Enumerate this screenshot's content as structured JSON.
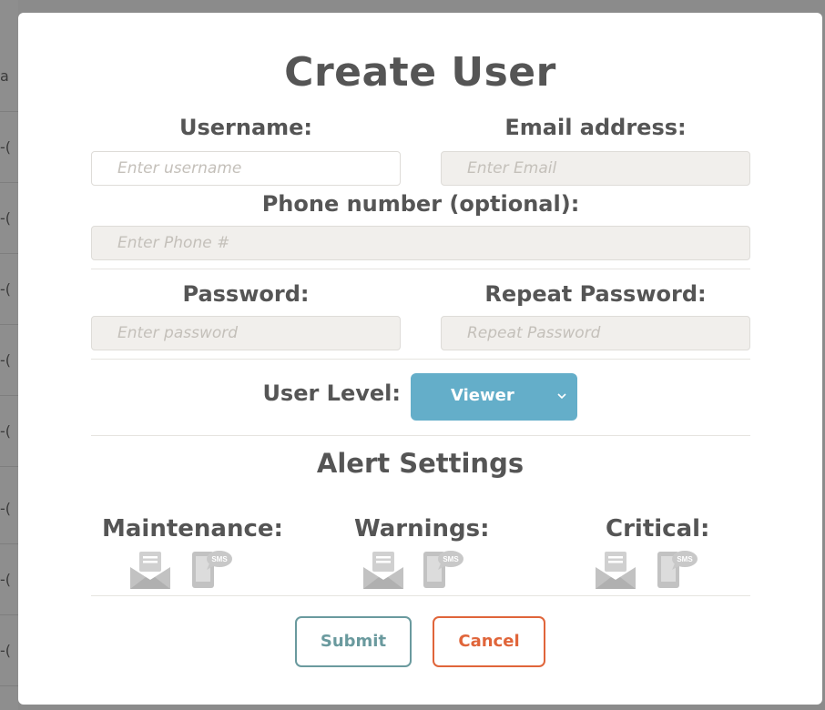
{
  "background": {
    "cells": [
      "a",
      "-(",
      "-(",
      "-(",
      "-(",
      "-(",
      "-(",
      "-(",
      "-("
    ]
  },
  "modal": {
    "title": "Create User",
    "fields": {
      "username": {
        "label": "Username:",
        "placeholder": "Enter username",
        "value": ""
      },
      "email": {
        "label": "Email address:",
        "placeholder": "Enter Email",
        "value": ""
      },
      "phone": {
        "label": "Phone number (optional):",
        "placeholder": "Enter Phone #",
        "value": ""
      },
      "password": {
        "label": "Password:",
        "placeholder": "Enter password",
        "value": ""
      },
      "repeat_password": {
        "label": "Repeat Password:",
        "placeholder": "Repeat Password",
        "value": ""
      }
    },
    "user_level": {
      "label": "User Level:",
      "selected": "Viewer"
    },
    "alert_settings": {
      "title": "Alert Settings",
      "groups": [
        {
          "label": "Maintenance:",
          "email_icon": "email-icon",
          "sms_icon": "sms-icon"
        },
        {
          "label": "Warnings:",
          "email_icon": "email-icon",
          "sms_icon": "sms-icon"
        },
        {
          "label": "Critical:",
          "email_icon": "email-icon",
          "sms_icon": "sms-icon"
        }
      ],
      "sms_text": "SMS"
    },
    "buttons": {
      "submit": "Submit",
      "cancel": "Cancel"
    },
    "colors": {
      "select_bg": "#64aec9",
      "submit": "#6a9a9e",
      "cancel": "#e0653a",
      "icon": "#c8c8c8"
    }
  }
}
